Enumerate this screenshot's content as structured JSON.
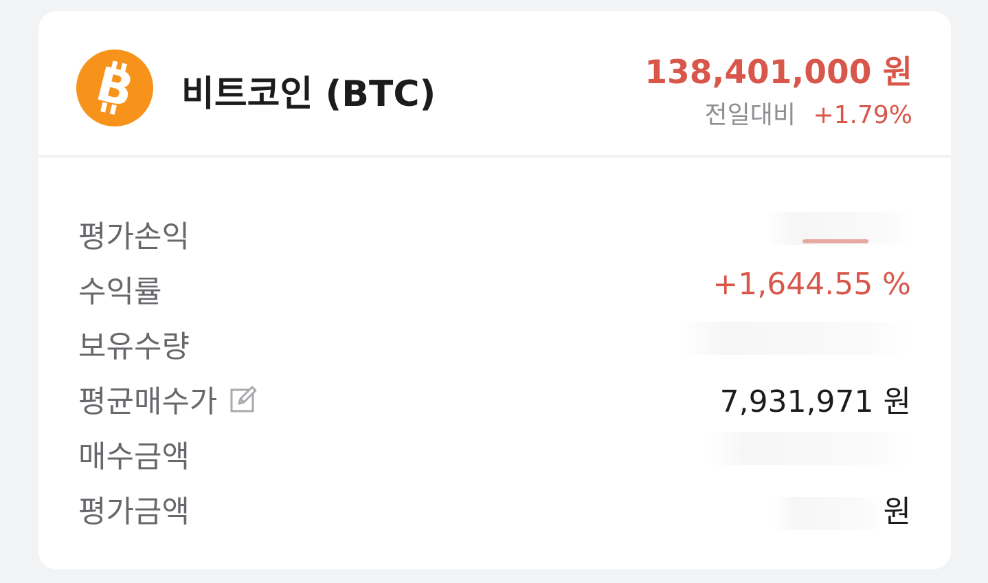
{
  "coin": {
    "name": "비트코인 (BTC)",
    "icon": "bitcoin-icon",
    "logo_color": "#f7931a"
  },
  "price": {
    "value": "138,401,000 원",
    "change_label": "전일대비",
    "change_value": "+1.79%"
  },
  "details": [
    {
      "label": "평가손익",
      "value": ""
    },
    {
      "label": "수익률",
      "value": "+1,644.55 %"
    },
    {
      "label": "보유수량",
      "value": ""
    },
    {
      "label": "평균매수가",
      "value": "7,931,971 원",
      "icon": "edit-icon"
    },
    {
      "label": "매수금액",
      "value": ""
    },
    {
      "label": "평가금액",
      "value": "원"
    }
  ],
  "colors": {
    "up": "#d8564a",
    "label": "#66686c",
    "text": "#1c1c1e"
  }
}
